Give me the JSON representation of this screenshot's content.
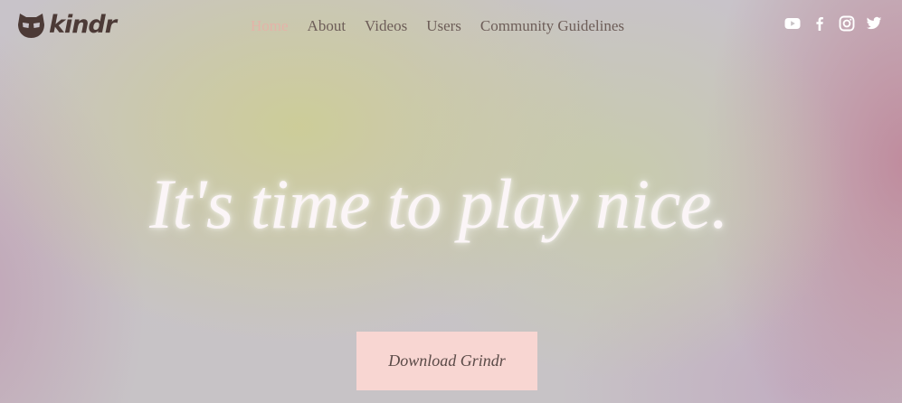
{
  "brand": {
    "logo_text": "kindr",
    "logo_icon": "mask-icon"
  },
  "nav": {
    "items": [
      {
        "label": "Home",
        "active": true
      },
      {
        "label": "About"
      },
      {
        "label": "Videos"
      },
      {
        "label": "Users"
      },
      {
        "label": "Community Guidelines"
      }
    ]
  },
  "social": {
    "icons": [
      "youtube-icon",
      "facebook-icon",
      "instagram-icon",
      "twitter-icon"
    ]
  },
  "hero": {
    "title": "It's time to play nice.",
    "cta_label": "Download Grindr"
  },
  "colors": {
    "nav_text": "#6d5d58",
    "nav_active": "#e4b3a8",
    "logo": "#4c3a36",
    "cta_bg": "#f8d6d2",
    "hero_text": "#fbf5f7"
  }
}
